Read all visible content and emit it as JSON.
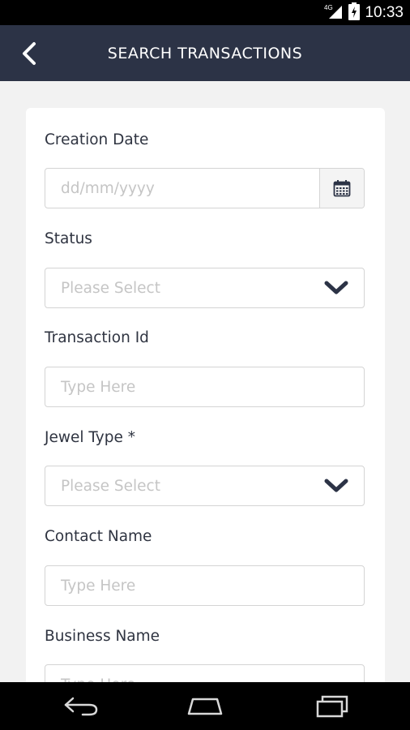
{
  "status_bar": {
    "time": "10:33",
    "network_label": "4G",
    "icons": [
      "network-signal-icon",
      "battery-icon"
    ]
  },
  "header": {
    "title": "SEARCH TRANSACTIONS",
    "back_icon": "back-chevron-icon"
  },
  "form": {
    "creation_date": {
      "label": "Creation Date",
      "placeholder": "dd/mm/yyyy",
      "icon": "calendar-icon"
    },
    "status": {
      "label": "Status",
      "placeholder": "Please Select",
      "icon": "chevron-down-icon"
    },
    "transaction_id": {
      "label": "Transaction Id",
      "placeholder": "Type Here"
    },
    "jewel_type": {
      "label": "Jewel Type *",
      "placeholder": "Please Select",
      "icon": "chevron-down-icon"
    },
    "contact_name": {
      "label": "Contact Name",
      "placeholder": "Type Here"
    },
    "business_name": {
      "label": "Business Name",
      "placeholder": "Type Here"
    }
  },
  "nav_bar": {
    "icons": [
      "nav-back-icon",
      "nav-home-icon",
      "nav-recents-icon"
    ]
  },
  "colors": {
    "header_bg": "#2c3346",
    "page_bg": "#f2f2f2",
    "card_bg": "#ffffff",
    "label_text": "#2f3441",
    "placeholder_text": "#c5c5c5",
    "field_border": "#d4d4d4"
  }
}
